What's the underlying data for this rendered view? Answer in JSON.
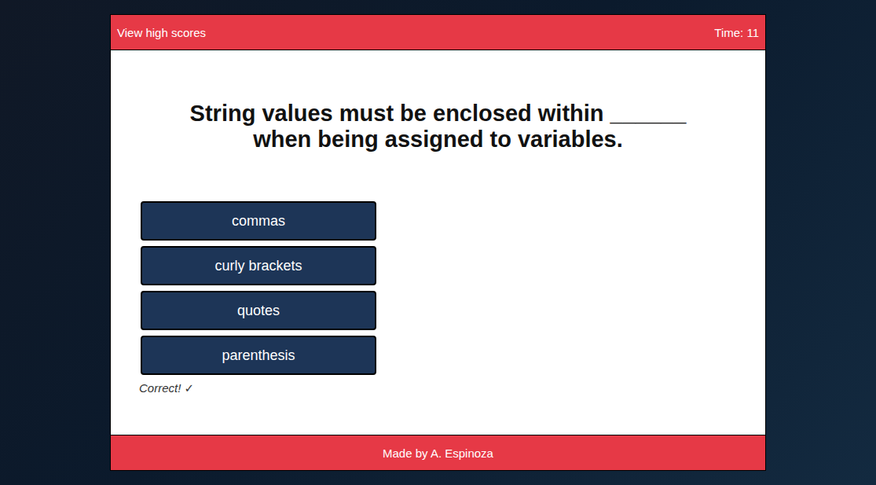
{
  "header": {
    "link": "View high scores",
    "timer": "Time: 11"
  },
  "question": "String values must be enclosed within ______ when being assigned to variables.",
  "answers": [
    {
      "label": "commas"
    },
    {
      "label": "curly brackets"
    },
    {
      "label": "quotes"
    },
    {
      "label": "parenthesis"
    }
  ],
  "feedback": "Correct! ✓",
  "footer": "Made by A. Espinoza"
}
